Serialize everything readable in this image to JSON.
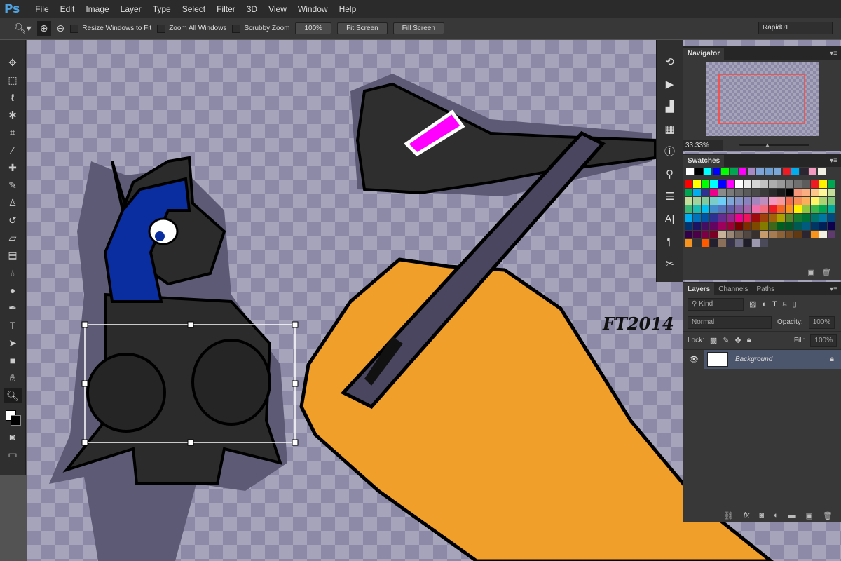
{
  "app": {
    "logo": "Ps",
    "menu": [
      "File",
      "Edit",
      "Image",
      "Layer",
      "Type",
      "Select",
      "Filter",
      "3D",
      "View",
      "Window",
      "Help"
    ]
  },
  "options": {
    "resize_windows": "Resize Windows to Fit",
    "zoom_all": "Zoom All Windows",
    "scrubby": "Scrubby Zoom",
    "btn_100": "100%",
    "fit_screen": "Fit Screen",
    "fill_screen": "Fill Screen",
    "workspace": "Rapid01"
  },
  "navigator": {
    "title": "Navigator",
    "zoom": "33.33%"
  },
  "swatches": {
    "title": "Swatches",
    "top_row": [
      "#ffffff",
      "#000000",
      "#00ffff",
      "#0000ff",
      "#00ff00",
      "#00a651",
      "#ff00ff",
      "#a689c5",
      "#7ea3d6",
      "#6e9fd4",
      "#7aa6d8",
      "#ed1c24",
      "#00aeef",
      "#2a2530",
      "#f49ac1",
      "#f2efe3"
    ],
    "rows": [
      [
        "#ff0000",
        "#ffff00",
        "#00ff00",
        "#00ffff",
        "#0000ff",
        "#ff00ff",
        "#ffffff",
        "#ebebeb",
        "#d6d6d6",
        "#c2c2c2",
        "#adadad",
        "#999999",
        "#858585",
        "#707070",
        "#5c5c5c",
        "#ed1c24",
        "#fff200",
        "#00a651"
      ],
      [
        "#00a651",
        "#00aeef",
        "#2e3192",
        "#ec008c",
        "#8a8a8a",
        "#7a7a7a",
        "#6a6a6a",
        "#5a5a5a",
        "#4a4a4a",
        "#3a3a3a",
        "#2a2a2a",
        "#1a1a1a",
        "#000000",
        "#f7977a",
        "#f9ad81",
        "#fdc68a",
        "#fff79a",
        "#c4df9b"
      ],
      [
        "#c4df9b",
        "#a3d39c",
        "#82ca9d",
        "#7bcdc8",
        "#6ecff6",
        "#7ea7d8",
        "#8493ca",
        "#8882be",
        "#a187be",
        "#bc8dbf",
        "#f49ac2",
        "#f6989d",
        "#f26c4f",
        "#f68e55",
        "#fbaf5c",
        "#fff467",
        "#acd372",
        "#7cc576"
      ],
      [
        "#3bb878",
        "#1abbb4",
        "#00bff3",
        "#438ccb",
        "#5574b9",
        "#605ca8",
        "#855fa8",
        "#a763a8",
        "#f06eaa",
        "#f26d7d",
        "#ed1c24",
        "#f26522",
        "#f7941d",
        "#fff200",
        "#8dc73f",
        "#39b54a",
        "#00a651",
        "#00a99d"
      ],
      [
        "#00aeef",
        "#0072bc",
        "#0054a6",
        "#2e3192",
        "#662d91",
        "#92278f",
        "#ec008c",
        "#ed145b",
        "#9e0b0f",
        "#a0410d",
        "#a36209",
        "#aba000",
        "#598527",
        "#197b30",
        "#007236",
        "#00746b",
        "#0076a3",
        "#004a80"
      ],
      [
        "#003471",
        "#1b1464",
        "#440e62",
        "#630460",
        "#9e005d",
        "#9e0039",
        "#790000",
        "#7b2e00",
        "#7d4900",
        "#827b00",
        "#406618",
        "#005e20",
        "#005826",
        "#005952",
        "#005b7f",
        "#003663",
        "#002157",
        "#0d004c"
      ],
      [
        "#32004b",
        "#4b0049",
        "#7b0046",
        "#7a0026",
        "#c7b299",
        "#998675",
        "#736357",
        "#534741",
        "#37302d",
        "#c69c6d",
        "#a67c52",
        "#8c6239",
        "#754c24",
        "#603913",
        "#2a2530",
        "#f7941d",
        "#f2efe3",
        "#5f3a6e"
      ],
      [
        "#f7941d",
        "#333333",
        "#ff5a00",
        "#231f2e",
        "#8b6f5a",
        "#36324a",
        "#6b6882",
        "#1f1d2a",
        "#9b98b0",
        "#4a4a5a"
      ]
    ]
  },
  "layers": {
    "tabs": [
      "Layers",
      "Channels",
      "Paths"
    ],
    "filter": "Kind",
    "blend": "Normal",
    "opacity_label": "Opacity:",
    "opacity": "100%",
    "lock_label": "Lock:",
    "fill_label": "Fill:",
    "fill": "100%",
    "items": [
      {
        "name": "Background"
      }
    ]
  },
  "artwork": {
    "signature": "FT2014",
    "colors": {
      "skin": "#2b2b2b",
      "hair": "#0a2da0",
      "hand": "#f0a02a",
      "pen": "#4a4660",
      "sleeve": "#2e2e2e",
      "shadow": "#5c5a74",
      "marker": "#ff00ff"
    }
  }
}
